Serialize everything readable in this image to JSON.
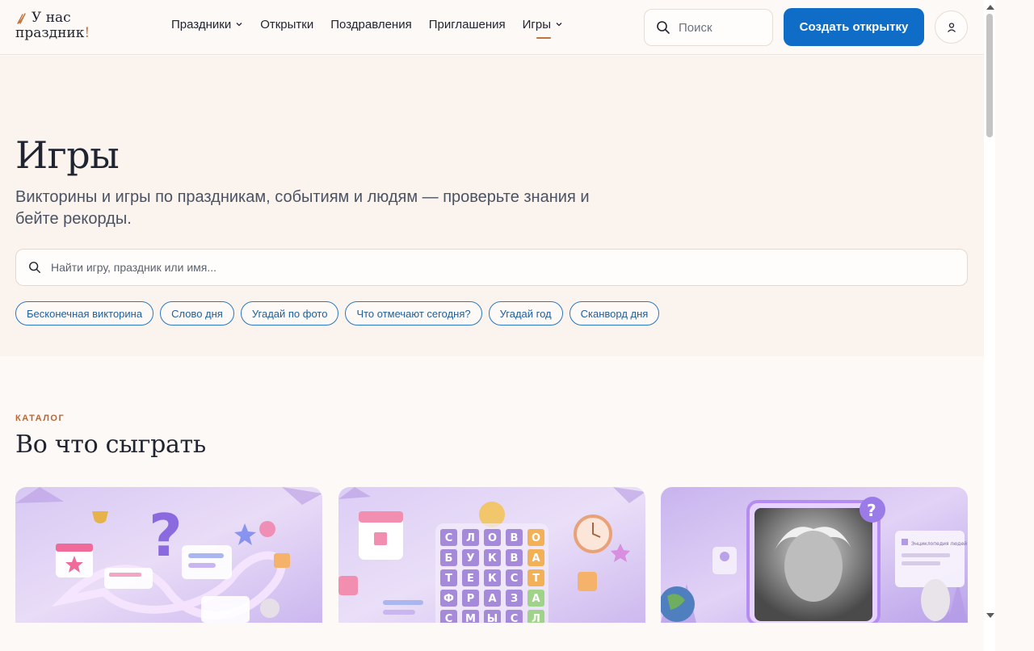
{
  "header": {
    "logo_line1": "У нас",
    "logo_line2": "праздник",
    "logo_excl": "!",
    "nav": [
      {
        "label": "Праздники",
        "has_dropdown": true
      },
      {
        "label": "Открытки",
        "has_dropdown": false
      },
      {
        "label": "Поздравления",
        "has_dropdown": false
      },
      {
        "label": "Приглашения",
        "has_dropdown": false
      },
      {
        "label": "Игры",
        "has_dropdown": true,
        "active": true
      }
    ],
    "search_label": "Поиск",
    "create_button": "Создать открытку",
    "accent_color": "#c0743c",
    "brand_color": "#0f6dc8"
  },
  "hero": {
    "title": "Игры",
    "subtitle": "Викторины и игры по праздникам, событиям и людям — проверьте знания и бейте рекорды.",
    "search_placeholder": "Найти игру, праздник или имя...",
    "chips": [
      "Бесконечная викторина",
      "Слово дня",
      "Угадай по фото",
      "Что отмечают сегодня?",
      "Угадай год",
      "Сканворд дня"
    ]
  },
  "catalog": {
    "eyebrow": "КАТАЛОГ",
    "title": "Во что сыграть",
    "cards": [
      {
        "icon": "infinite-quiz-illustration"
      },
      {
        "icon": "word-of-day-illustration",
        "tiles": [
          "С",
          "Л",
          "О",
          "В",
          "О",
          "Б",
          "У",
          "К",
          "В",
          "А",
          "Т",
          "Е",
          "К",
          "С",
          "Т",
          "Ф",
          "Р",
          "А",
          "З",
          "А",
          "С",
          "М",
          "Ы",
          "С",
          "Л"
        ]
      },
      {
        "icon": "guess-by-photo-illustration",
        "caption": "Энциклопедия людей"
      }
    ]
  }
}
